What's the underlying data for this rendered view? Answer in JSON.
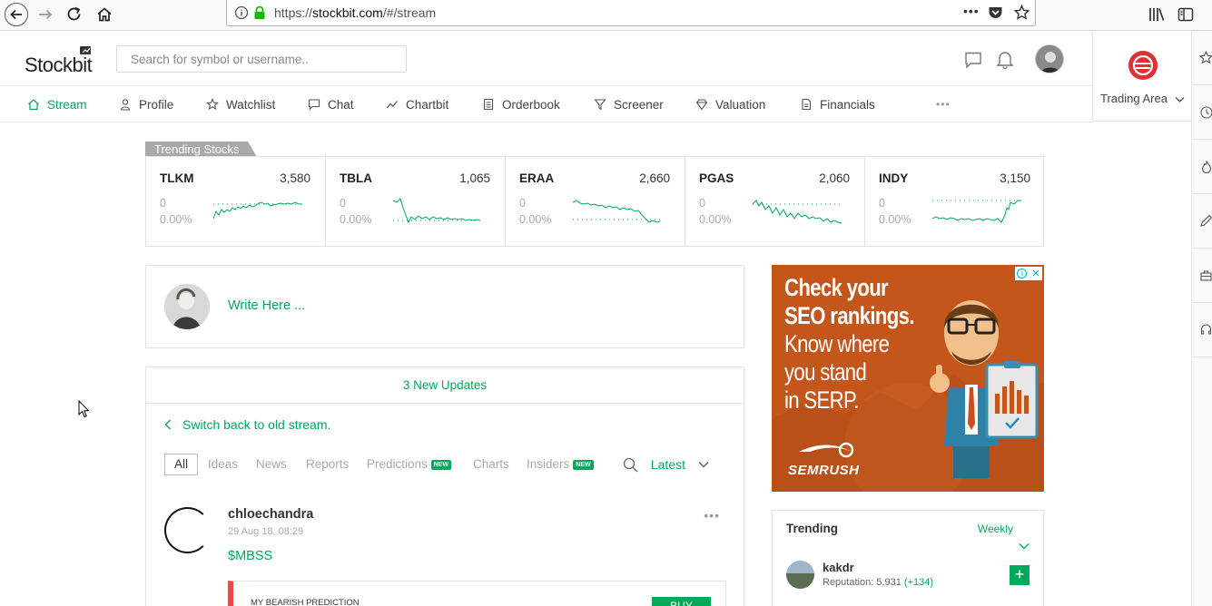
{
  "browser": {
    "url_prefix": "https://",
    "url_host": "stockbit.com",
    "url_path": "/#/stream",
    "more_label": "•••"
  },
  "app": {
    "logo": "Stockbit",
    "search_placeholder": "Search for symbol or username..",
    "trading_area_label": "Trading Area"
  },
  "tabs": [
    {
      "label": "Stream",
      "icon": "home-icon",
      "active": true
    },
    {
      "label": "Profile",
      "icon": "person-icon"
    },
    {
      "label": "Watchlist",
      "icon": "star-icon"
    },
    {
      "label": "Chat",
      "icon": "chat-icon"
    },
    {
      "label": "Chartbit",
      "icon": "chart-line-icon"
    },
    {
      "label": "Orderbook",
      "icon": "document-icon"
    },
    {
      "label": "Screener",
      "icon": "filter-icon"
    },
    {
      "label": "Valuation",
      "icon": "diamond-icon"
    },
    {
      "label": "Financials",
      "icon": "report-icon"
    }
  ],
  "tabs_more": "•••",
  "trending_stocks": {
    "label": "Trending Stocks",
    "items": [
      {
        "symbol": "TLKM",
        "price": "3,580",
        "change": "0",
        "percent": "0.00%"
      },
      {
        "symbol": "TBLA",
        "price": "1,065",
        "change": "0",
        "percent": "0.00%"
      },
      {
        "symbol": "ERAA",
        "price": "2,660",
        "change": "0",
        "percent": "0.00%"
      },
      {
        "symbol": "PGAS",
        "price": "2,060",
        "change": "0",
        "percent": "0.00%"
      },
      {
        "symbol": "INDY",
        "price": "3,150",
        "change": "0",
        "percent": "0.00%"
      }
    ]
  },
  "composer": {
    "prompt": "Write Here ..."
  },
  "stream": {
    "new_updates": "3 New Updates",
    "switch_label": "Switch back to old stream.",
    "filters": [
      {
        "label": "All",
        "active": true
      },
      {
        "label": "Ideas"
      },
      {
        "label": "News"
      },
      {
        "label": "Reports"
      },
      {
        "label": "Predictions",
        "badge": "NEW"
      },
      {
        "label": "Charts"
      },
      {
        "label": "Insiders",
        "badge": "NEW"
      }
    ],
    "sort_label": "Latest",
    "post": {
      "username": "chloechandra",
      "time": "29 Aug 18, 08:29",
      "symbol": "$MBSS",
      "more": "•••",
      "prediction_label": "MY BEARISH PREDICTION",
      "action_label": "BUY"
    }
  },
  "ad": {
    "line1": "Check your",
    "line2": "SEO rankings.",
    "line3": "Know where",
    "line4": "you stand",
    "line5": "in SERP.",
    "brand": "SEMRUSH",
    "close_info": "i",
    "close_x": "✕"
  },
  "trending_users": {
    "title": "Trending",
    "period": "Weekly",
    "user": {
      "name": "kakdr",
      "reputation_label": "Reputation: 5,931",
      "reputation_delta": "(+134)",
      "follow_label": "+"
    }
  },
  "colors": {
    "accent": "#00a85a",
    "ad_bg": "#c85a1e",
    "bearish": "#ee4a4a"
  }
}
